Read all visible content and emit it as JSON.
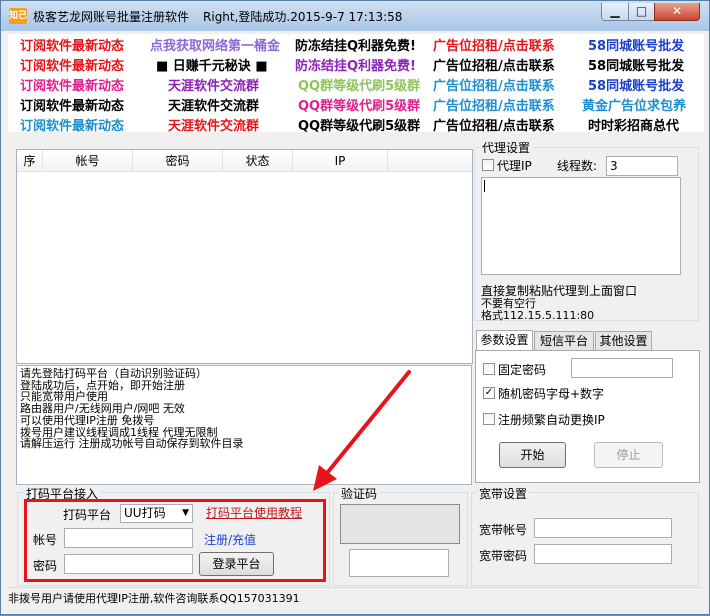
{
  "window": {
    "app_title": "极客艺龙网账号批量注册软件",
    "status_text": "Right,登陆成功.2015-9-7 17:13:58",
    "app_icon_text": "知己",
    "min_glyph": "▁",
    "max_glyph": "□",
    "close_glyph": "✕"
  },
  "ads": [
    {
      "text": "订阅软件最新动态",
      "color": "#e8141b"
    },
    {
      "text": "点我获取网络第一桶金",
      "color": "#8a6ad6"
    },
    {
      "text": "防冻结挂Q利器免费!",
      "color": "#000000"
    },
    {
      "text": "广告位招租/点击联系",
      "color": "#e8141b"
    },
    {
      "text": "58同城账号批发",
      "color": "#1b3fd0"
    },
    {
      "text": "订阅软件最新动态",
      "color": "#e8141b"
    },
    {
      "text": "■  日赚千元秘诀  ■",
      "color": "#000000"
    },
    {
      "text": "防冻结挂Q利器免费!",
      "color": "#8e22b6"
    },
    {
      "text": "广告位招租/点击联系",
      "color": "#000000"
    },
    {
      "text": "58同城账号批发",
      "color": "#000000"
    },
    {
      "text": "订阅软件最新动态",
      "color": "#e0208e"
    },
    {
      "text": "天涯软件交流群",
      "color": "#8e22b6"
    },
    {
      "text": "QQ群等级代刷5级群",
      "color": "#8fc35d"
    },
    {
      "text": "广告位招租/点击联系",
      "color": "#1b8fd0"
    },
    {
      "text": "58同城账号批发",
      "color": "#1b3fd0"
    },
    {
      "text": "订阅软件最新动态",
      "color": "#000000"
    },
    {
      "text": "天涯软件交流群",
      "color": "#000000"
    },
    {
      "text": "QQ群等级代刷5级群",
      "color": "#e0208e"
    },
    {
      "text": "广告位招租/点击联系",
      "color": "#1b8fd0"
    },
    {
      "text": "黄金广告位求包养",
      "color": "#1b8fd0"
    },
    {
      "text": "订阅软件最新动态",
      "color": "#1b8fd0"
    },
    {
      "text": "天涯软件交流群",
      "color": "#e8141b"
    },
    {
      "text": "QQ群等级代刷5级群",
      "color": "#000000"
    },
    {
      "text": "广告位招租/点击联系",
      "color": "#000000"
    },
    {
      "text": "时时彩招商总代",
      "color": "#000000"
    }
  ],
  "account_list": {
    "columns": [
      "序",
      "帐号",
      "密码",
      "状态",
      "IP"
    ]
  },
  "log_lines": [
    "请先登陆打码平台（自动识别验证码）",
    "登陆成功后，点开始，即开始注册",
    "只能宽带用户使用",
    "路由器用户/无线网用户/网吧 无效",
    "可以使用代理IP注册 免拨号",
    "拨号用户建议线程调成1线程 代理无限制",
    "请解压运行 注册成功帐号自动保存到软件目录"
  ],
  "proxy": {
    "group_label": "代理设置",
    "proxy_ip_label": "代理IP",
    "threads_label": "线程数:",
    "threads_value": "3",
    "hint1": "直接复制粘贴代理到上面窗口",
    "hint2": "不要有空行",
    "hint3": "格式112.15.5.111:80"
  },
  "tabs": [
    "参数设置",
    "短信平台",
    "其他设置"
  ],
  "params": {
    "fixed_password_label": "固定密码",
    "random_password_label": "随机密码字母+数字",
    "random_password_checked": "✓",
    "auto_change_ip_label": "注册频繁自动更换IP",
    "start_label": "开始",
    "stop_label": "停止"
  },
  "captcha_platform": {
    "group_label": "打码平台接入",
    "platform_label": "打码平台",
    "platform_value": "UU打码",
    "dropdown_glyph": "▼",
    "usage_link": "打码平台使用教程",
    "account_label": "帐号",
    "register_link": "注册/充值",
    "password_label": "密码",
    "login_button": "登录平台"
  },
  "captcha": {
    "group_label": "验证码"
  },
  "broadband": {
    "group_label": "宽带设置",
    "account_label": "宽带帐号",
    "password_label": "宽带密码"
  },
  "statusbar": {
    "text": "非拨号用户请使用代理IP注册,软件咨询联系QQ157031391"
  },
  "colors": {
    "annotation_red": "#e8141b",
    "link_red": "#c0191e",
    "link_blue": "#1b3fd0"
  }
}
